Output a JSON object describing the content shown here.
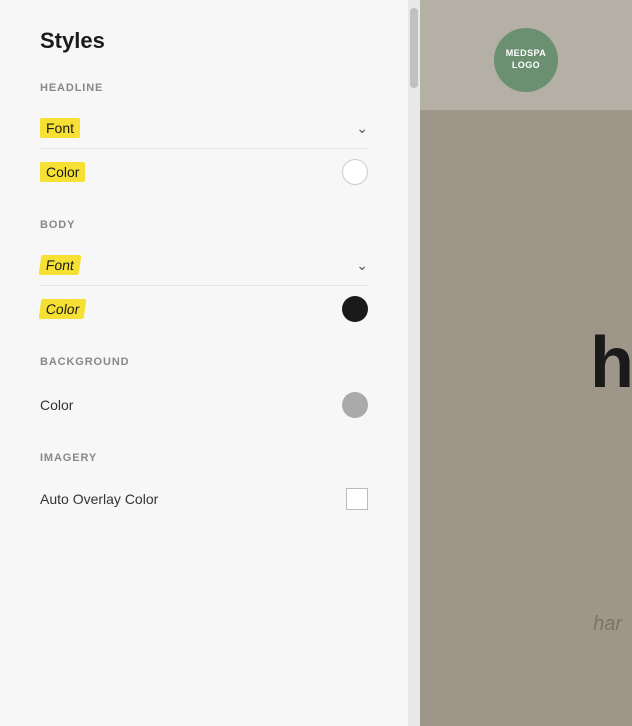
{
  "panel": {
    "title": "Styles",
    "sections": {
      "headline": {
        "label": "HEADLINE",
        "font_label": "Font",
        "color_label": "Color"
      },
      "body": {
        "label": "BODY",
        "font_label": "Font",
        "color_label": "Color"
      },
      "background": {
        "label": "BACKGROUND",
        "color_label": "Color"
      },
      "imagery": {
        "label": "IMAGERY",
        "auto_overlay_label": "Auto Overlay Color"
      }
    }
  },
  "right_panel": {
    "logo_line1": "MEDSPA",
    "logo_line2": "LOGO",
    "har_text": "har",
    "bold_letter": "h"
  },
  "icons": {
    "chevron": "›",
    "chevron_down": "⌄"
  }
}
